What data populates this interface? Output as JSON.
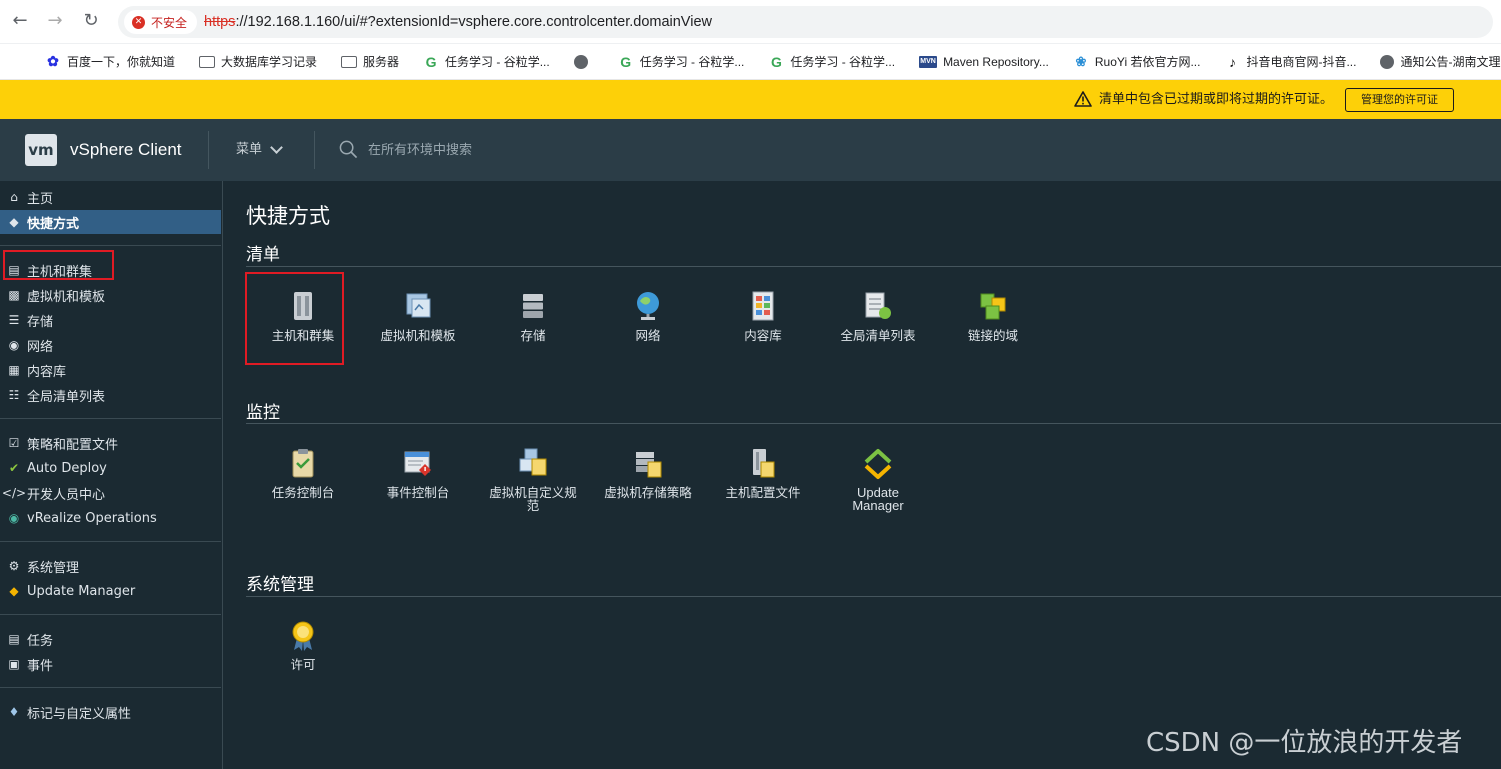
{
  "browser": {
    "insecure_label": "不安全",
    "url_scheme": "https",
    "url_rest": "://192.168.1.160/ui/#?extensionId=vsphere.core.controlcenter.domainView",
    "bookmarks": [
      {
        "label": "百度一下，你就知道",
        "icon": "baidu-icon"
      },
      {
        "label": "大数据库学习记录",
        "icon": "folder-icon"
      },
      {
        "label": "服务器",
        "icon": "folder-icon"
      },
      {
        "label": "任务学习 - 谷粒学...",
        "icon": "g-icon"
      },
      {
        "label": "",
        "icon": "globe-icon"
      },
      {
        "label": "任务学习 - 谷粒学...",
        "icon": "g-icon"
      },
      {
        "label": "任务学习 - 谷粒学...",
        "icon": "g-icon"
      },
      {
        "label": "Maven Repository...",
        "icon": "maven-icon"
      },
      {
        "label": "RuoYi 若依官方网...",
        "icon": "ruoyi-icon"
      },
      {
        "label": "抖音电商官网-抖音...",
        "icon": "tiktok-icon"
      },
      {
        "label": "通知公告-湖南文理",
        "icon": "globe-icon"
      }
    ]
  },
  "license_banner": {
    "text": "清单中包含已过期或即将过期的许可证。",
    "button": "管理您的许可证",
    "color": "#fdd008"
  },
  "header": {
    "logo": "vm",
    "title": "vSphere Client",
    "menu": "菜单",
    "search_placeholder": "在所有环境中搜索"
  },
  "sidebar": {
    "home": "主页",
    "shortcuts": "快捷方式",
    "hosts_clusters": "主机和群集",
    "vms_templates": "虚拟机和模板",
    "storage": "存储",
    "network": "网络",
    "content_library": "内容库",
    "global_inventory": "全局清单列表",
    "policies": "策略和配置文件",
    "auto_deploy": "Auto Deploy",
    "dev_center": "开发人员中心",
    "vrealize": "vRealize Operations",
    "administration": "系统管理",
    "update_manager": "Update Manager",
    "tasks": "任务",
    "events": "事件",
    "tags": "标记与自定义属性"
  },
  "main": {
    "title": "快捷方式",
    "inventory": {
      "heading": "清单",
      "tiles": [
        "主机和群集",
        "虚拟机和模板",
        "存储",
        "网络",
        "内容库",
        "全局清单列表",
        "链接的域"
      ]
    },
    "monitoring": {
      "heading": "监控",
      "tiles": [
        "任务控制台",
        "事件控制台",
        "虚拟机自定义规范",
        "虚拟机存储策略",
        "主机配置文件",
        "Update Manager"
      ]
    },
    "administration": {
      "heading": "系统管理",
      "tiles": [
        "许可"
      ]
    }
  },
  "accent_color": "#325f86",
  "highlight_color": "#e01b24",
  "watermark": "CSDN @一位放浪的开发者"
}
